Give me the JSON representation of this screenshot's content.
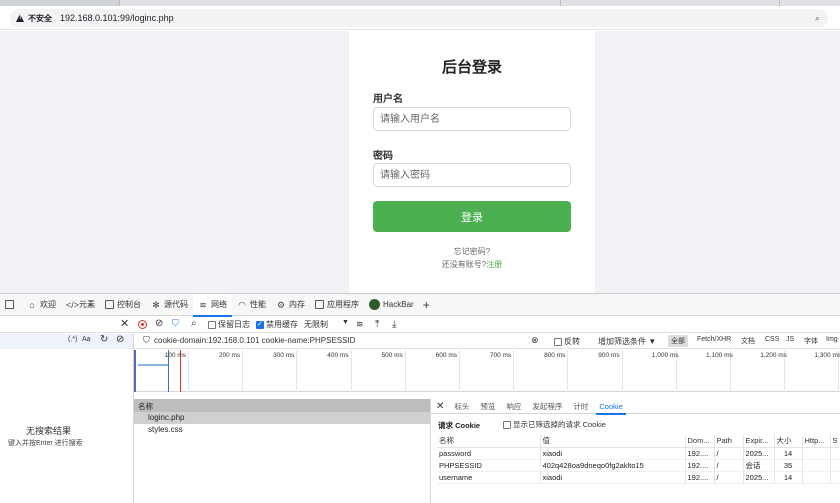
{
  "browser": {
    "insecure_label": "不安全",
    "url": "192.168.0.101:99/loginc.php"
  },
  "login": {
    "title": "后台登录",
    "username_label": "用户名",
    "username_placeholder": "请输入用户名",
    "password_label": "密码",
    "password_placeholder": "请输入密码",
    "submit_label": "登录",
    "forgot_label": "忘记密码?",
    "no_account_label": "还没有账号?",
    "register_label": "注册"
  },
  "devtools": {
    "tabs": [
      {
        "label": "欢迎",
        "icon": "home-icon"
      },
      {
        "label": "元素",
        "icon": "code-icon"
      },
      {
        "label": "控制台",
        "icon": "console-icon"
      },
      {
        "label": "源代码",
        "icon": "bug-icon"
      },
      {
        "label": "网络",
        "icon": "wifi-icon"
      },
      {
        "label": "性能",
        "icon": "gauge-icon"
      },
      {
        "label": "内存",
        "icon": "gear-icon"
      },
      {
        "label": "应用程序",
        "icon": "app-icon"
      },
      {
        "label": "HackBar",
        "icon": "hackbar-icon"
      }
    ],
    "active_tab": "网络",
    "toolbar": {
      "preserve_log": "保留日志",
      "disable_cache": "禁用缓存",
      "throttle": "无限制"
    },
    "left_search": {
      "regex_label": "(.*)",
      "case_label": "Aa"
    },
    "filter": {
      "text": "cookie-domain:192.168.0.101 cookie-name:PHPSESSID",
      "invert_label": "反转",
      "more_filters": "增加筛选条件",
      "types": [
        "全部",
        "Fetch/XHR",
        "文档",
        "CSS",
        "JS",
        "字体",
        "Img"
      ]
    },
    "timeline_ticks": [
      "100 ms",
      "200 ms",
      "300 ms",
      "400 ms",
      "500 ms",
      "600 ms",
      "700 ms",
      "800 ms",
      "900 ms",
      "1,000 ms",
      "1,100 ms",
      "1,200 ms",
      "1,300 ms"
    ],
    "no_results": "无搜索结果",
    "no_results_hint": "键入并按Enter 进行搜索",
    "requests": {
      "header": "名称",
      "rows": [
        "loginc.php",
        "styles.css"
      ]
    },
    "detail": {
      "tabs": [
        "标头",
        "预览",
        "响应",
        "发起程序",
        "计时",
        "Cookie"
      ],
      "active_tab": "Cookie",
      "request_cookie_title": "请求 Cookie",
      "show_filtered": "显示已筛选掉的请求 Cookie",
      "columns": [
        "名称",
        "值",
        "Dom...",
        "Path",
        "Expir...",
        "大小",
        "Http...",
        "S"
      ],
      "cookies": [
        [
          "password",
          "xiaodi",
          "192....",
          "/",
          "2025...",
          "14",
          "",
          ""
        ],
        [
          "PHPSESSID",
          "402q428oa9dneqo0fg2aklto15",
          "192....",
          "/",
          "会话",
          "35",
          "",
          ""
        ],
        [
          "username",
          "xiaodi",
          "192....",
          "/",
          "2025...",
          "14",
          "",
          ""
        ]
      ]
    }
  },
  "colors": {
    "login_button": "#4caf50",
    "register_link": "#4caf50",
    "devtools_accent": "#1a73e8",
    "record_red": "#d93025"
  }
}
